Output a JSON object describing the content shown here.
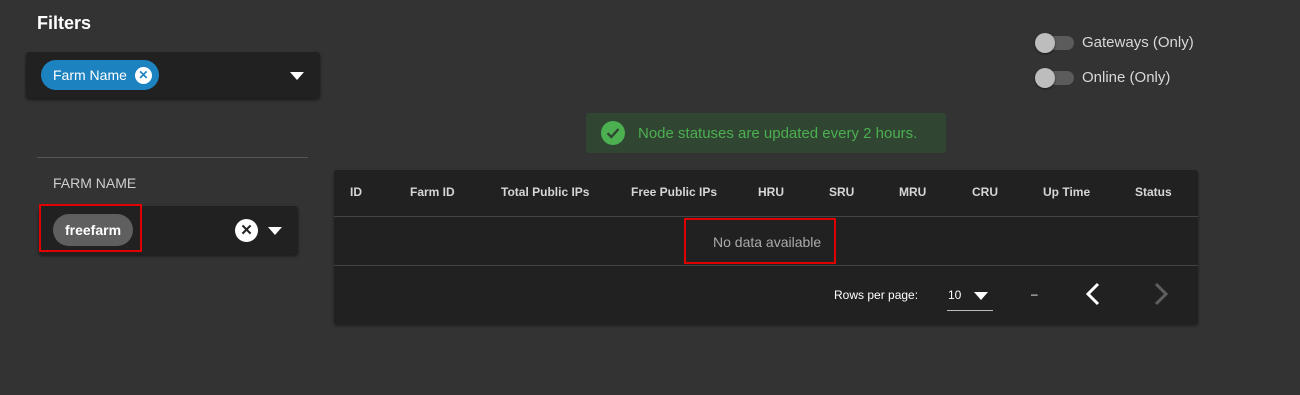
{
  "filters": {
    "title": "Filters",
    "chip_label": "Farm Name",
    "chip_close_icon": "close-icon",
    "dropdown_icon": "caret-down-icon"
  },
  "toggles": {
    "gateways_label": "Gateways (Only)",
    "gateways_on": false,
    "online_label": "Online (Only)",
    "online_on": false
  },
  "farm_filter": {
    "label": "FARM NAME",
    "selected_chip": "freefarm",
    "clear_icon": "close-icon",
    "dropdown_icon": "caret-down-icon"
  },
  "status_banner": {
    "icon": "check-circle-icon",
    "text": "Node statuses are updated every 2 hours.",
    "color": "#4caf50"
  },
  "table": {
    "headers": [
      "ID",
      "Farm ID",
      "Total Public IPs",
      "Free Public IPs",
      "HRU",
      "SRU",
      "MRU",
      "CRU",
      "Up Time",
      "Status"
    ],
    "rows": [],
    "empty_text": "No data available"
  },
  "pagination": {
    "rows_per_page_label": "Rows per page:",
    "rows_per_page_value": "10",
    "range_text": "–",
    "prev_icon": "chevron-left-icon",
    "next_icon": "chevron-right-icon"
  },
  "colors": {
    "background": "#333333",
    "surface": "#212121",
    "chip_blue": "#1c82c0",
    "highlight_red": "#e00000"
  }
}
